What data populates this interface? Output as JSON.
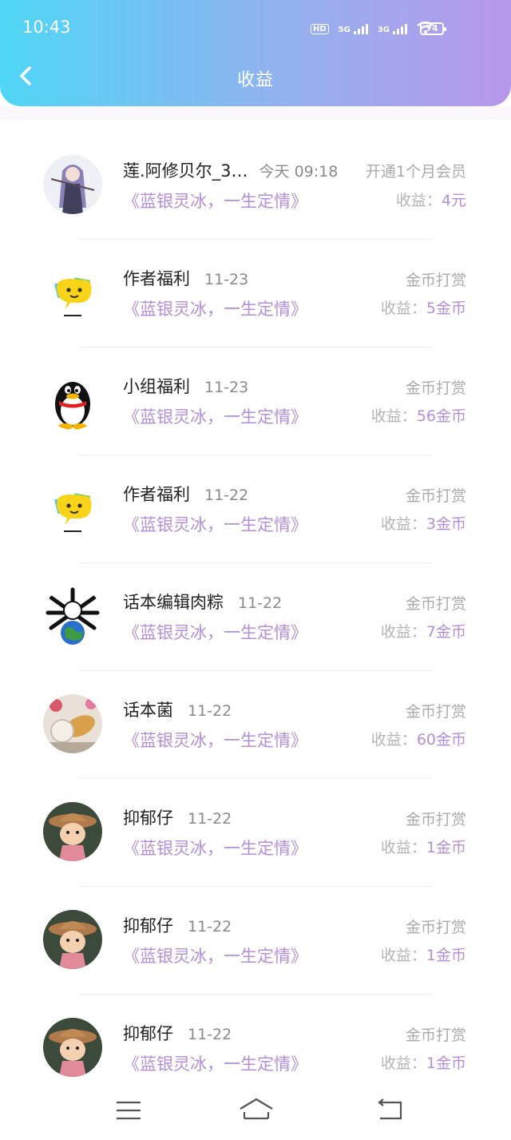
{
  "status": {
    "time": "10:43",
    "hd": "HD",
    "net1": "5G",
    "net2": "3G",
    "battery": "74"
  },
  "header": {
    "title": "收益"
  },
  "items": [
    {
      "name": "莲.阿修贝尔_3…",
      "date": "今天 09:18",
      "type": "开通1个月会员",
      "book": "《蓝银灵冰，一生定情》",
      "earn_label": "收益：",
      "earn_value": "4元",
      "avatar": "anime-girl-avatar"
    },
    {
      "name": "作者福利",
      "date": "11-23",
      "type": "金币打赏",
      "book": "《蓝银灵冰，一生定情》",
      "earn_label": "收益：",
      "earn_value": "5金币",
      "avatar": "yellow-chat-avatar"
    },
    {
      "name": "小组福利",
      "date": "11-23",
      "type": "金币打赏",
      "book": "《蓝银灵冰，一生定情》",
      "earn_label": "收益：",
      "earn_value": "56金币",
      "avatar": "penguin-avatar"
    },
    {
      "name": "作者福利",
      "date": "11-22",
      "type": "金币打赏",
      "book": "《蓝银灵冰，一生定情》",
      "earn_label": "收益：",
      "earn_value": "3金币",
      "avatar": "yellow-chat-avatar"
    },
    {
      "name": "话本编辑肉粽",
      "date": "11-22",
      "type": "金币打赏",
      "book": "《蓝银灵冰，一生定情》",
      "earn_label": "收益：",
      "earn_value": "7金币",
      "avatar": "earth-bones-avatar"
    },
    {
      "name": "话本菌",
      "date": "11-22",
      "type": "金币打赏",
      "book": "《蓝银灵冰，一生定情》",
      "earn_label": "收益：",
      "earn_value": "60金币",
      "avatar": "food-photo-avatar"
    },
    {
      "name": "抑郁仔",
      "date": "11-22",
      "type": "金币打赏",
      "book": "《蓝银灵冰，一生定情》",
      "earn_label": "收益：",
      "earn_value": "1金币",
      "avatar": "cartoon-kid-avatar"
    },
    {
      "name": "抑郁仔",
      "date": "11-22",
      "type": "金币打赏",
      "book": "《蓝银灵冰，一生定情》",
      "earn_label": "收益：",
      "earn_value": "1金币",
      "avatar": "cartoon-kid-avatar"
    },
    {
      "name": "抑郁仔",
      "date": "11-22",
      "type": "金币打赏",
      "book": "《蓝银灵冰，一生定情》",
      "earn_label": "收益：",
      "earn_value": "1金币",
      "avatar": "cartoon-kid-avatar"
    }
  ],
  "nav": {
    "menu_icon": "menu-icon",
    "home_icon": "home-icon",
    "back_icon": "back-icon"
  },
  "colors": {
    "accent": "#b48ed8",
    "header_start": "#4fd6f5",
    "header_end": "#b797ea"
  }
}
